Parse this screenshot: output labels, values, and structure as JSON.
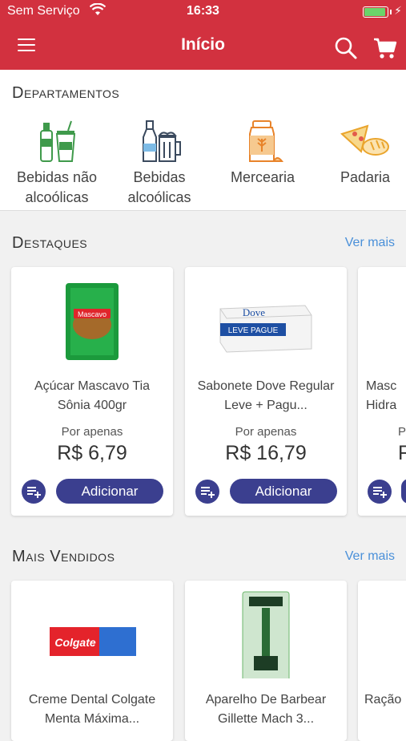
{
  "status_bar": {
    "carrier": "Sem Serviço",
    "time": "16:33",
    "battery_level": 0.95
  },
  "nav": {
    "title": "Início"
  },
  "departments": {
    "title": "Departamentos",
    "items": [
      {
        "label": "Bebidas não alcoólicas",
        "icon": "soft-drinks-icon"
      },
      {
        "label": "Bebidas alcoólicas",
        "icon": "beer-bottle-icon"
      },
      {
        "label": "Mercearia",
        "icon": "grocery-jar-icon"
      },
      {
        "label": "Padaria",
        "icon": "bread-pizza-icon"
      }
    ]
  },
  "highlights": {
    "title": "Destaques",
    "see_more": "Ver mais",
    "products": [
      {
        "name": "Açúcar Mascavo Tia Sônia 400gr",
        "by_label": "Por apenas",
        "price": "R$ 6,79",
        "add_label": "Adicionar"
      },
      {
        "name": "Sabonete Dove Regular Leve + Pagu...",
        "by_label": "Por apenas",
        "price": "R$ 16,79",
        "add_label": "Adicionar"
      },
      {
        "name": "Masc Hidra",
        "by_label": "Po",
        "price": "R",
        "add_label": ""
      }
    ]
  },
  "best_sellers": {
    "title": "Mais Vendidos",
    "see_more": "Ver mais",
    "products": [
      {
        "name": "Creme Dental Colgate Menta Máxima..."
      },
      {
        "name": "Aparelho De Barbear Gillette Mach 3..."
      },
      {
        "name": "Ração"
      }
    ]
  },
  "colors": {
    "primary": "#d2313f",
    "button": "#3b3f8f",
    "link": "#4a90d9"
  },
  "product_image_text": {
    "sugar_brand": "Mascavo",
    "dove_brand": "Dove",
    "dove_promo": "LEVE PAGUE",
    "colgate_brand": "Colgate"
  }
}
